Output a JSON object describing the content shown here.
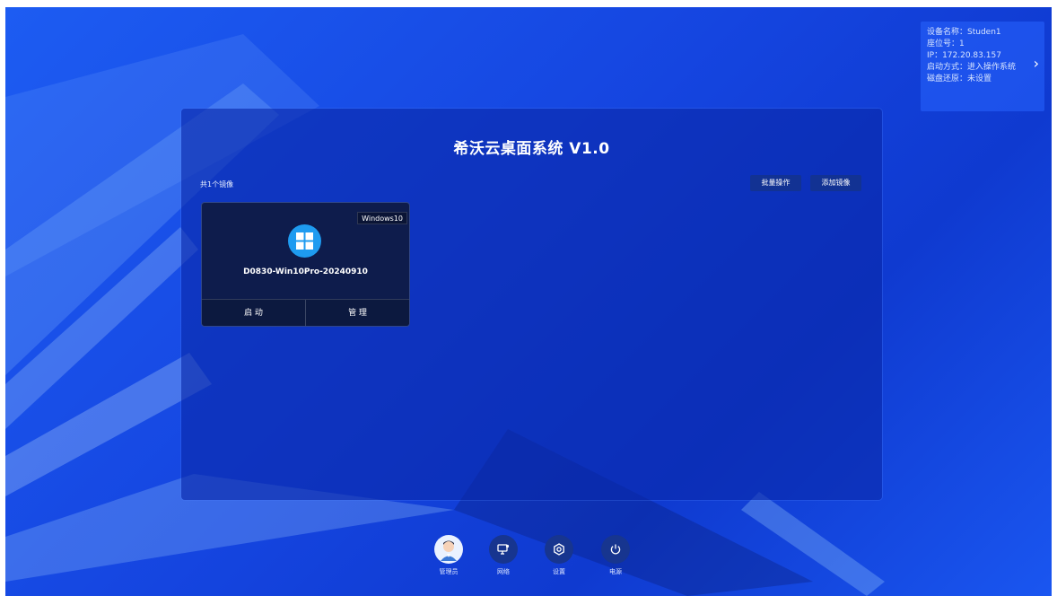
{
  "device_info": {
    "device_name": "设备名称：Studen1",
    "seat_number": "座位号：1",
    "ip": "IP：172.20.83.157",
    "boot_mode": "启动方式：进入操作系统",
    "disk_restore": "磁盘还原：未设置",
    "expand_icon": "chevron-right-icon"
  },
  "main": {
    "title": "希沃云桌面系统 V1.0",
    "image_count": "共1个镜像",
    "batch_button": "批量操作",
    "add_button": "添加镜像"
  },
  "images": [
    {
      "os_tag": "Windows10",
      "name": "D0830-Win10Pro-20240910",
      "icon": "windows-logo-icon",
      "start_label": "启 动",
      "manage_label": "管 理"
    }
  ],
  "dock": {
    "admin": "管理员",
    "network": "网络",
    "settings": "设置",
    "power": "电源"
  },
  "colors": {
    "background": "#1a4fe8",
    "panel": "#0a28aa",
    "card": "#0e1c4c",
    "windows_blue": "#1e9bf0"
  }
}
